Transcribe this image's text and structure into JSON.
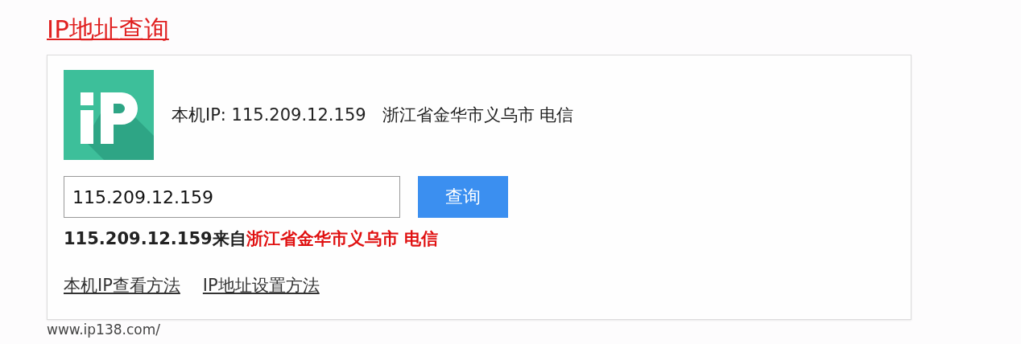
{
  "title": "IP地址查询",
  "local_ip": {
    "label": "本机IP: 115.209.12.159",
    "location": "浙江省金华市义乌市 电信"
  },
  "search": {
    "value": "115.209.12.159",
    "button": "查询"
  },
  "result": {
    "prefix": "115.209.12.159来自",
    "location": "浙江省金华市义乌市 电信"
  },
  "links": [
    "本机IP查看方法",
    "IP地址设置方法"
  ],
  "url": "www.ip138.com/"
}
